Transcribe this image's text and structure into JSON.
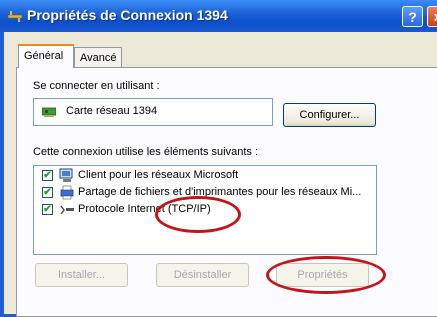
{
  "window": {
    "title": "Propriétés de Connexion 1394",
    "help_label": "?",
    "close_label": "x"
  },
  "tabs": [
    {
      "label": "Général"
    },
    {
      "label": "Avancé"
    }
  ],
  "connect_using": {
    "label": "Se connecter en utilisant :",
    "adapter": "Carte réseau 1394",
    "configure_button": "Configurer..."
  },
  "items_section": {
    "label": "Cette connexion utilise les éléments suivants :",
    "items": [
      {
        "label": "Client pour les réseaux Microsoft",
        "checked": true,
        "icon": "network-client-icon"
      },
      {
        "label": "Partage de fichiers et d'imprimantes pour les réseaux Mi...",
        "checked": true,
        "icon": "printer-share-icon"
      },
      {
        "label": "Protocole Internet (TCP/IP)",
        "checked": true,
        "icon": "protocol-icon"
      }
    ]
  },
  "buttons": {
    "install": "Installer...",
    "uninstall": "Désinstaller",
    "properties": "Propriétés"
  },
  "colors": {
    "titlebar": "#0d4fcb",
    "highlight_ring": "#c4141a",
    "dialog_bg": "#ece9d8"
  }
}
